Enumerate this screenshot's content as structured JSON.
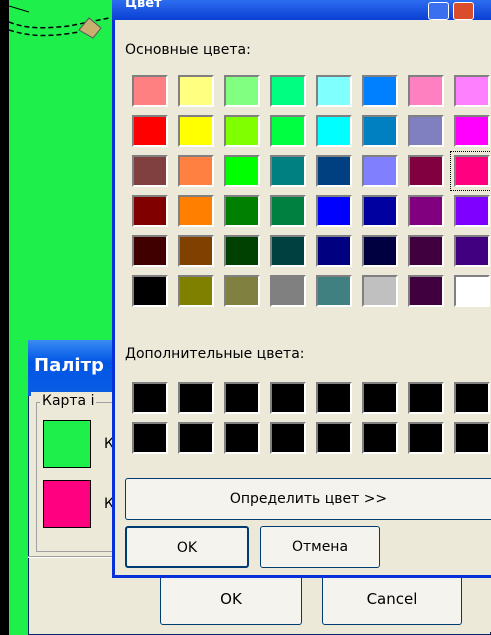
{
  "back_dialog": {
    "title": "Палітр",
    "group_label": "Карта і",
    "swatch_label_1": "К",
    "swatch_label_2": "К",
    "ok_label": "OK",
    "cancel_label": "Cancel"
  },
  "color_dialog": {
    "title": "Цвет",
    "basic_colors_label": "Основные цвета:",
    "custom_colors_label": "Дополнительные цвета:",
    "define_custom_label": "Определить цвет >>",
    "ok_label": "OK",
    "cancel_label": "Отмена",
    "basic_colors": [
      [
        "#ff8080",
        "#ffff80",
        "#80ff80",
        "#00ff80",
        "#80ffff",
        "#0080ff",
        "#ff80c0",
        "#ff80ff"
      ],
      [
        "#ff0000",
        "#ffff00",
        "#80ff00",
        "#00ff40",
        "#00ffff",
        "#0080c0",
        "#8080c0",
        "#ff00ff"
      ],
      [
        "#804040",
        "#ff8040",
        "#00ff00",
        "#008080",
        "#004080",
        "#8080ff",
        "#800040",
        "#ff0080"
      ],
      [
        "#800000",
        "#ff8000",
        "#008000",
        "#008040",
        "#0000ff",
        "#0000a0",
        "#800080",
        "#8000ff"
      ],
      [
        "#400000",
        "#804000",
        "#004000",
        "#004040",
        "#000080",
        "#000040",
        "#400040",
        "#400080"
      ],
      [
        "#000000",
        "#808000",
        "#808040",
        "#808080",
        "#408080",
        "#c0c0c0",
        "#400040",
        "#ffffff"
      ]
    ],
    "selected_color": "#ff0080",
    "custom_colors": [
      [
        "#000000",
        "#000000",
        "#000000",
        "#000000",
        "#000000",
        "#000000",
        "#000000",
        "#000000"
      ],
      [
        "#000000",
        "#000000",
        "#000000",
        "#000000",
        "#000000",
        "#000000",
        "#000000",
        "#000000"
      ]
    ]
  }
}
